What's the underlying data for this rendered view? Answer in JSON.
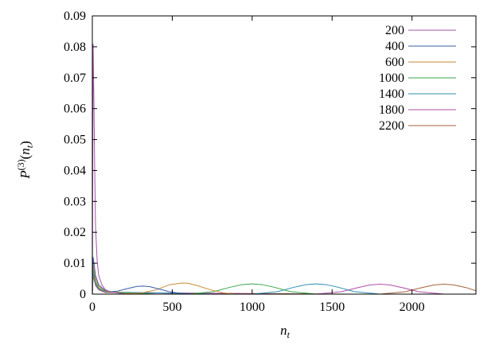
{
  "chart_data": {
    "type": "line",
    "xlabel": "n_t",
    "ylabel": "P^(3)(n_t)",
    "xlim": [
      0,
      2400
    ],
    "ylim": [
      0,
      0.09
    ],
    "xticks": [
      0,
      500,
      1000,
      1500,
      2000
    ],
    "yticks": [
      0,
      0.01,
      0.02,
      0.03,
      0.04,
      0.05,
      0.06,
      0.07,
      0.08,
      0.09
    ],
    "x_tick_labels": [
      "0",
      "500",
      "1000",
      "1500",
      "2000"
    ],
    "y_tick_labels": [
      "0",
      "0.01",
      "0.02",
      "0.03",
      "0.04",
      "0.05",
      "0.06",
      "0.07",
      "0.08",
      "0.09"
    ],
    "grid": false,
    "legend_position": "top-right",
    "series": [
      {
        "name": "200",
        "color": "#a455a8",
        "x": [
          0,
          5,
          10,
          15,
          20,
          30,
          40,
          60,
          80,
          100,
          150,
          200,
          250,
          300,
          400
        ],
        "y": [
          0.0,
          0.081,
          0.062,
          0.04,
          0.022,
          0.011,
          0.006,
          0.003,
          0.0015,
          0.001,
          0.0004,
          0.0001,
          0.0,
          0.0,
          0.0
        ]
      },
      {
        "name": "400",
        "color": "#3d5ca8",
        "x": [
          0,
          5,
          10,
          20,
          40,
          80,
          120,
          160,
          220,
          280,
          320,
          360,
          420,
          480,
          560,
          640,
          700
        ],
        "y": [
          0.0,
          0.012,
          0.01,
          0.006,
          0.003,
          0.0012,
          0.0008,
          0.001,
          0.0018,
          0.0025,
          0.0026,
          0.0024,
          0.0016,
          0.0008,
          0.0002,
          0.0,
          0.0
        ]
      },
      {
        "name": "600",
        "color": "#c98a35",
        "x": [
          0,
          5,
          10,
          20,
          40,
          80,
          200,
          300,
          400,
          480,
          560,
          600,
          660,
          740,
          820,
          900,
          1000
        ],
        "y": [
          0.0,
          0.01,
          0.008,
          0.005,
          0.0025,
          0.001,
          0.0002,
          0.0003,
          0.0014,
          0.003,
          0.0036,
          0.0035,
          0.0027,
          0.0014,
          0.0004,
          0.0,
          0.0
        ]
      },
      {
        "name": "1000",
        "color": "#3aa54a",
        "x": [
          0,
          5,
          10,
          20,
          40,
          80,
          400,
          600,
          760,
          860,
          940,
          1000,
          1060,
          1140,
          1240,
          1400
        ],
        "y": [
          0.0,
          0.009,
          0.007,
          0.004,
          0.002,
          0.0008,
          0.0,
          0.0,
          0.0008,
          0.0022,
          0.0031,
          0.0033,
          0.0031,
          0.0022,
          0.0008,
          0.0
        ]
      },
      {
        "name": "1400",
        "color": "#2a8fb0",
        "x": [
          0,
          5,
          10,
          20,
          40,
          80,
          800,
          1000,
          1160,
          1260,
          1340,
          1400,
          1460,
          1540,
          1640,
          1800
        ],
        "y": [
          0.0,
          0.008,
          0.006,
          0.0035,
          0.0018,
          0.0007,
          0.0,
          0.0,
          0.0008,
          0.0022,
          0.0031,
          0.0033,
          0.0031,
          0.0022,
          0.0008,
          0.0
        ]
      },
      {
        "name": "1800",
        "color": "#b14fa8",
        "x": [
          0,
          5,
          10,
          20,
          40,
          80,
          1200,
          1400,
          1560,
          1660,
          1740,
          1800,
          1860,
          1940,
          2040,
          2200
        ],
        "y": [
          0.0,
          0.007,
          0.0055,
          0.003,
          0.0015,
          0.0006,
          0.0,
          0.0,
          0.0008,
          0.0021,
          0.003,
          0.0032,
          0.003,
          0.0021,
          0.0008,
          0.0
        ]
      },
      {
        "name": "2200",
        "color": "#a5623a",
        "x": [
          0,
          5,
          10,
          20,
          40,
          80,
          1600,
          1800,
          1960,
          2060,
          2140,
          2200,
          2260,
          2340,
          2400
        ],
        "y": [
          0.0,
          0.006,
          0.005,
          0.0028,
          0.0014,
          0.0005,
          0.0,
          0.0,
          0.0008,
          0.0021,
          0.003,
          0.0032,
          0.003,
          0.0021,
          0.0011
        ]
      }
    ]
  }
}
